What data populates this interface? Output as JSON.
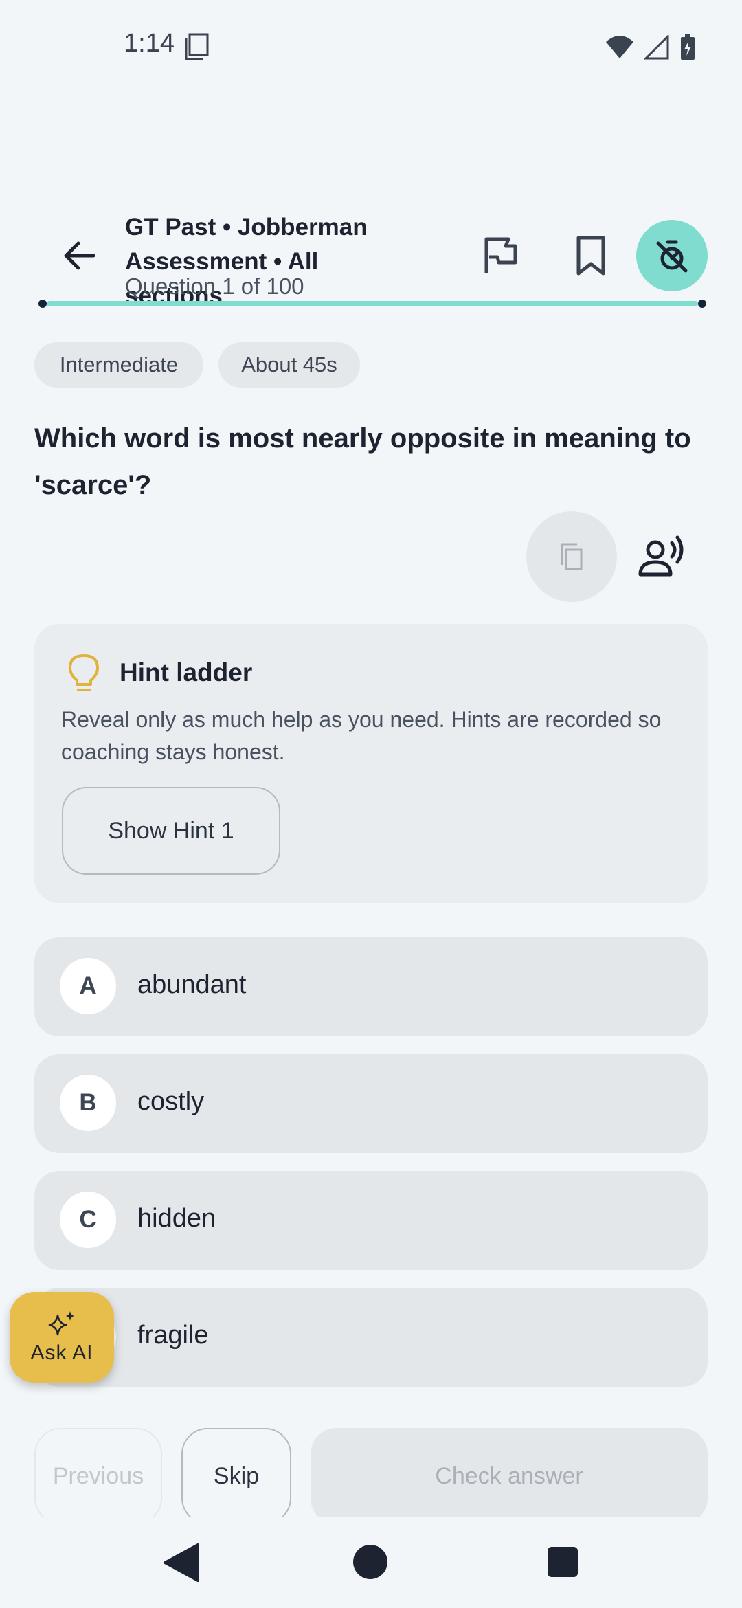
{
  "status_bar": {
    "time": "1:14"
  },
  "header": {
    "title": "GT Past • Jobberman Assessment • All sections",
    "subtitle": "Question 1 of 100",
    "progress": 0.01
  },
  "chips": {
    "level": "Intermediate",
    "time": "About 45s"
  },
  "question": {
    "text": "Which word is most nearly opposite in meaning to 'scarce'?"
  },
  "hint": {
    "title": "Hint ladder",
    "description": "Reveal only as much help as you need. Hints are recorded so coaching stays honest.",
    "button_label": "Show Hint 1"
  },
  "options": [
    {
      "letter": "A",
      "text": "abundant"
    },
    {
      "letter": "B",
      "text": "costly"
    },
    {
      "letter": "C",
      "text": "hidden"
    },
    {
      "letter": "D",
      "text": "fragile"
    }
  ],
  "fab": {
    "label": "Ask AI"
  },
  "bottom_bar": {
    "previous": "Previous",
    "skip": "Skip",
    "check": "Check answer"
  },
  "colors": {
    "accent": "#7fdccf",
    "fab": "#e7bd4c",
    "background": "#f3f6f8"
  }
}
